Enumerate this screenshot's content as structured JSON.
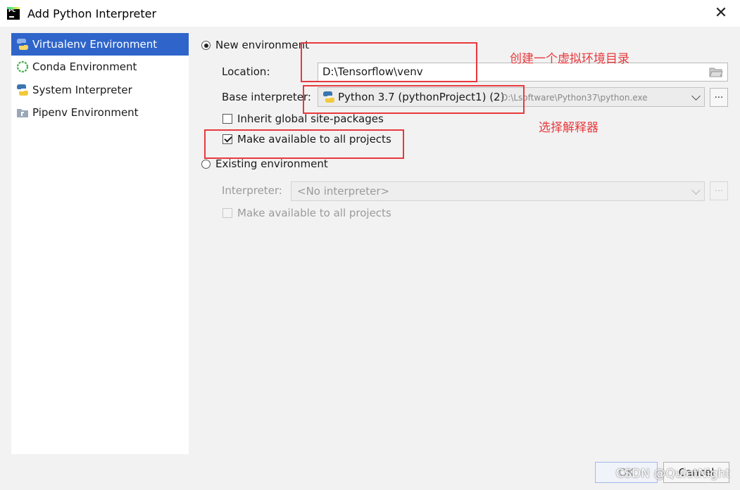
{
  "window": {
    "title": "Add Python Interpreter",
    "app_icon_text": "PC"
  },
  "sidebar": {
    "items": [
      {
        "label": "Virtualenv Environment",
        "icon": "virtualenv-icon",
        "selected": true
      },
      {
        "label": "Conda Environment",
        "icon": "conda-icon",
        "selected": false
      },
      {
        "label": "System Interpreter",
        "icon": "python-icon",
        "selected": false
      },
      {
        "label": "Pipenv Environment",
        "icon": "pipenv-icon",
        "selected": false
      }
    ]
  },
  "new_env": {
    "radio_label": "New environment",
    "location_label": "Location:",
    "location_value": "D:\\Tensorflow\\venv",
    "base_label": "Base interpreter:",
    "base_value": "Python 3.7 (pythonProject1) (2)",
    "base_path": "D:\\Lsoftware\\Python37\\python.exe",
    "browse_label": "...",
    "inherit_label": "Inherit global site-packages",
    "inherit_checked": false,
    "make_available_label": "Make available to all projects",
    "make_available_checked": true
  },
  "existing_env": {
    "radio_label": "Existing environment",
    "interpreter_label": "Interpreter:",
    "interpreter_value": "<No interpreter>",
    "browse_label": "...",
    "make_available_label": "Make available to all projects"
  },
  "annotations": {
    "note_location": "创建一个虚拟环境目录",
    "note_interpreter": "选择解释器",
    "color": "#e8393d"
  },
  "buttons": {
    "ok": "OK",
    "cancel": "Cancel"
  },
  "watermark": "CSDN @QuietNight",
  "colors": {
    "selection": "#2f65ca",
    "accent": "#e8393d"
  }
}
